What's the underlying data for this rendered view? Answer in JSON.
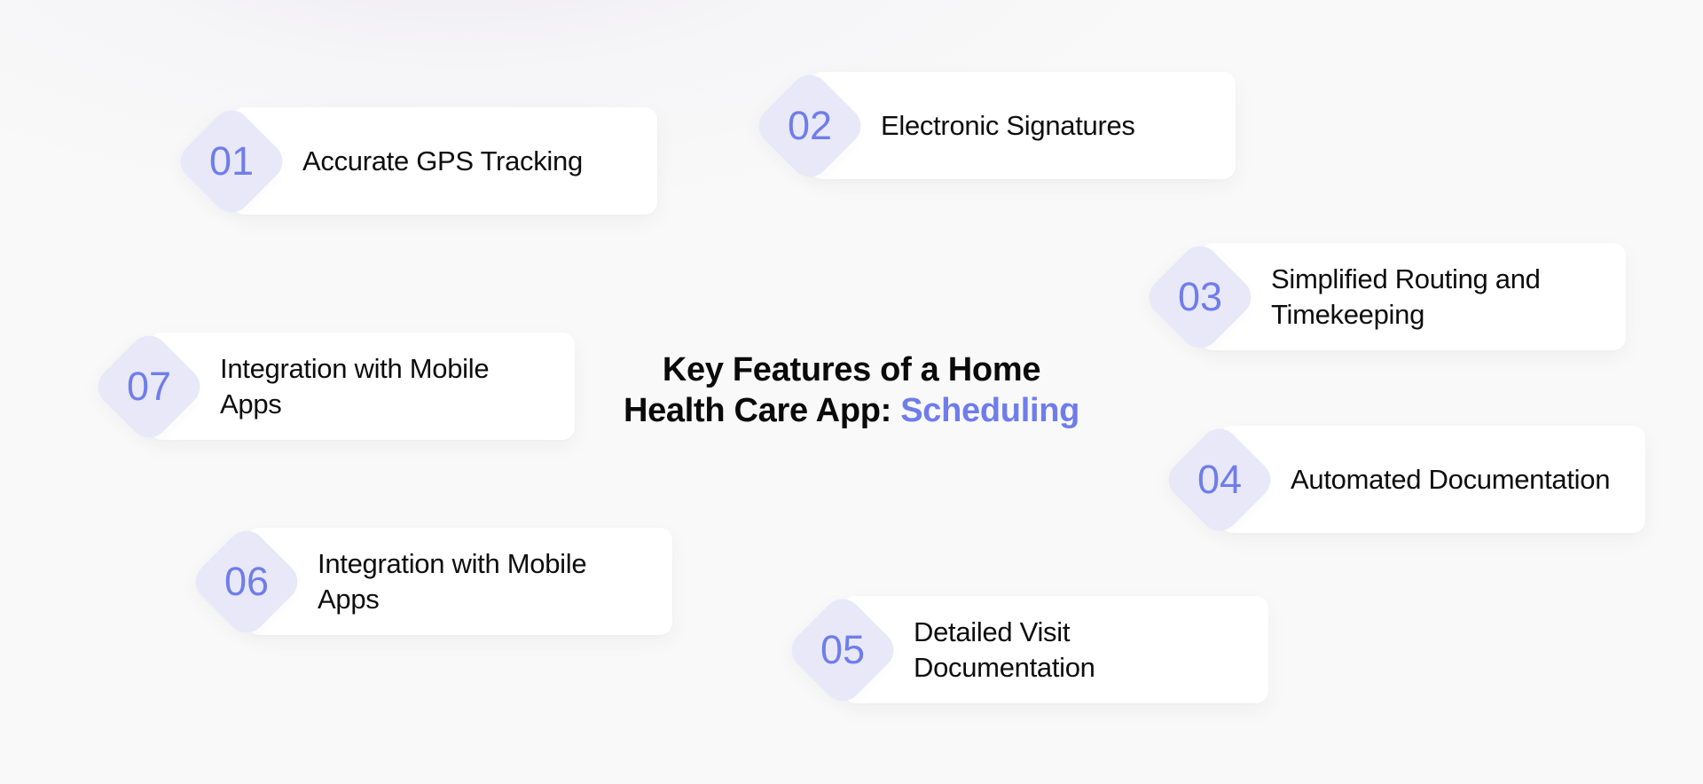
{
  "title": {
    "line1": "Key Features of a Home",
    "line2_prefix": "Health Care App: ",
    "line2_accent": "Scheduling"
  },
  "colors": {
    "accent": "#6f7deb",
    "diamond": "#e8e8f8",
    "card": "#ffffff",
    "background": "#f9f9f9",
    "text": "#0d0d0d"
  },
  "features": [
    {
      "number": "01",
      "label": "Accurate GPS Tracking"
    },
    {
      "number": "02",
      "label": "Electronic Signatures"
    },
    {
      "number": "03",
      "label": "Simplified Routing and Timekeeping"
    },
    {
      "number": "04",
      "label": "Automated Documentation"
    },
    {
      "number": "05",
      "label": "Detailed Visit Documentation"
    },
    {
      "number": "06",
      "label": "Integration with Mobile Apps"
    },
    {
      "number": "07",
      "label": "Integration with Mobile Apps"
    }
  ]
}
